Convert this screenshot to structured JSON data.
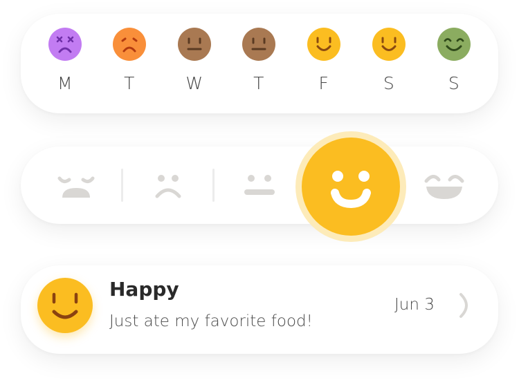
{
  "week": {
    "days": [
      {
        "letter": "M",
        "mood": "dizzy",
        "color": "#c27cf2"
      },
      {
        "letter": "T",
        "mood": "sad",
        "color": "#f98f3a"
      },
      {
        "letter": "W",
        "mood": "neutral",
        "color": "#a97952"
      },
      {
        "letter": "T",
        "mood": "neutral",
        "color": "#a97952"
      },
      {
        "letter": "F",
        "mood": "happy",
        "color": "#fbbd21"
      },
      {
        "letter": "S",
        "mood": "happy",
        "color": "#fbbd21"
      },
      {
        "letter": "S",
        "mood": "joyful",
        "color": "#8bac60"
      }
    ]
  },
  "selector": {
    "options": [
      "awful-face-icon",
      "sad-face-icon",
      "neutral-face-icon",
      "happy-face-icon",
      "joyful-face-icon"
    ],
    "selected": "happy",
    "inactive_color": "#d9d7d4",
    "selected_color": "#fbbd21"
  },
  "entry": {
    "title": "Happy",
    "note": "Just ate my favorite food!",
    "date": "Jun 3",
    "mood": "happy"
  }
}
